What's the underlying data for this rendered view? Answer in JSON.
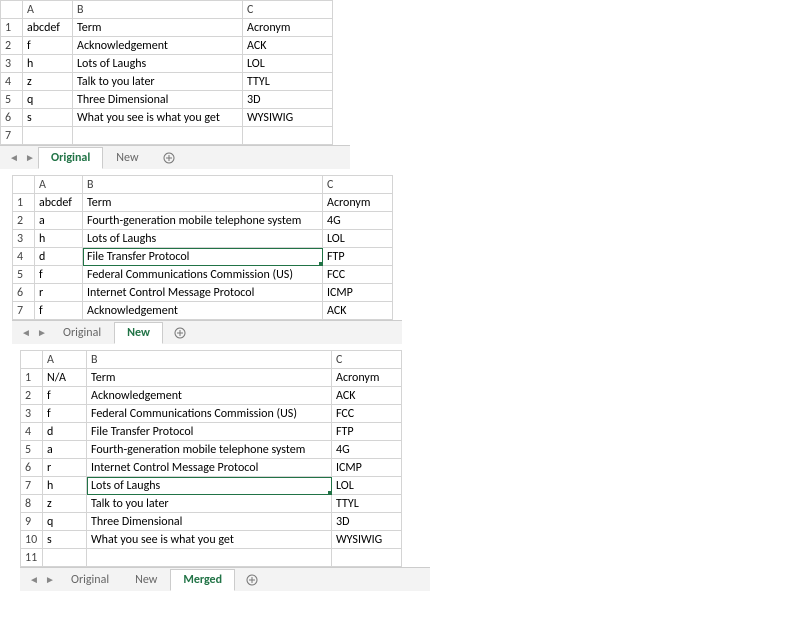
{
  "cols": [
    "A",
    "B",
    "C"
  ],
  "sheet1": {
    "tabs": [
      "Original",
      "New"
    ],
    "activeTab": 0,
    "headerRow": {
      "A": "abcdef",
      "B": "Term",
      "C": "Acronym"
    },
    "rows": [
      {
        "A": "f",
        "B": "Acknowledgement",
        "C": "ACK"
      },
      {
        "A": "h",
        "B": "Lots of Laughs",
        "C": "LOL"
      },
      {
        "A": "z",
        "B": "Talk to you later",
        "C": "TTYL"
      },
      {
        "A": "q",
        "B": "Three Dimensional",
        "C": "3D"
      },
      {
        "A": "s",
        "B": "What you see is what you get",
        "C": "WYSIWIG"
      }
    ],
    "rowNums": [
      "1",
      "2",
      "3",
      "4",
      "5",
      "6",
      "7"
    ]
  },
  "sheet2": {
    "tabs": [
      "Original",
      "New"
    ],
    "activeTab": 1,
    "headerRow": {
      "A": "abcdef",
      "B": "Term",
      "C": "Acronym"
    },
    "rows": [
      {
        "A": "a",
        "B": "Fourth-generation mobile telephone system",
        "C": "4G"
      },
      {
        "A": "h",
        "B": "Lots of Laughs",
        "C": "LOL"
      },
      {
        "A": "d",
        "B": "File Transfer Protocol",
        "C": "FTP"
      },
      {
        "A": "f",
        "B": "Federal Communications Commission (US)",
        "C": "FCC"
      },
      {
        "A": "r",
        "B": "Internet Control Message Protocol",
        "C": "ICMP"
      },
      {
        "A": "f",
        "B": "Acknowledgement",
        "C": "ACK"
      }
    ],
    "rowNums": [
      "1",
      "2",
      "3",
      "4",
      "5",
      "6",
      "7"
    ],
    "selectedCell": {
      "row": 4,
      "col": "B"
    }
  },
  "sheet3": {
    "tabs": [
      "Original",
      "New",
      "Merged"
    ],
    "activeTab": 2,
    "headerRow": {
      "A": "N/A",
      "B": "Term",
      "C": "Acronym"
    },
    "rows": [
      {
        "A": "f",
        "B": "Acknowledgement",
        "C": "ACK"
      },
      {
        "A": "f",
        "B": "Federal Communications Commission (US)",
        "C": "FCC"
      },
      {
        "A": "d",
        "B": "File Transfer Protocol",
        "C": "FTP"
      },
      {
        "A": "a",
        "B": "Fourth-generation mobile telephone system",
        "C": "4G"
      },
      {
        "A": "r",
        "B": "Internet Control Message Protocol",
        "C": "ICMP"
      },
      {
        "A": "h",
        "B": "Lots of Laughs",
        "C": "LOL"
      },
      {
        "A": "z",
        "B": "Talk to you later",
        "C": "TTYL"
      },
      {
        "A": "q",
        "B": "Three Dimensional",
        "C": "3D"
      },
      {
        "A": "s",
        "B": "What you see is what you get",
        "C": "WYSIWIG"
      }
    ],
    "rowNums": [
      "1",
      "2",
      "3",
      "4",
      "5",
      "6",
      "7",
      "8",
      "9",
      "10",
      "11"
    ],
    "selectedCell": {
      "row": 7,
      "col": "B"
    }
  },
  "nav": {
    "prev": "◄",
    "next": "►"
  }
}
